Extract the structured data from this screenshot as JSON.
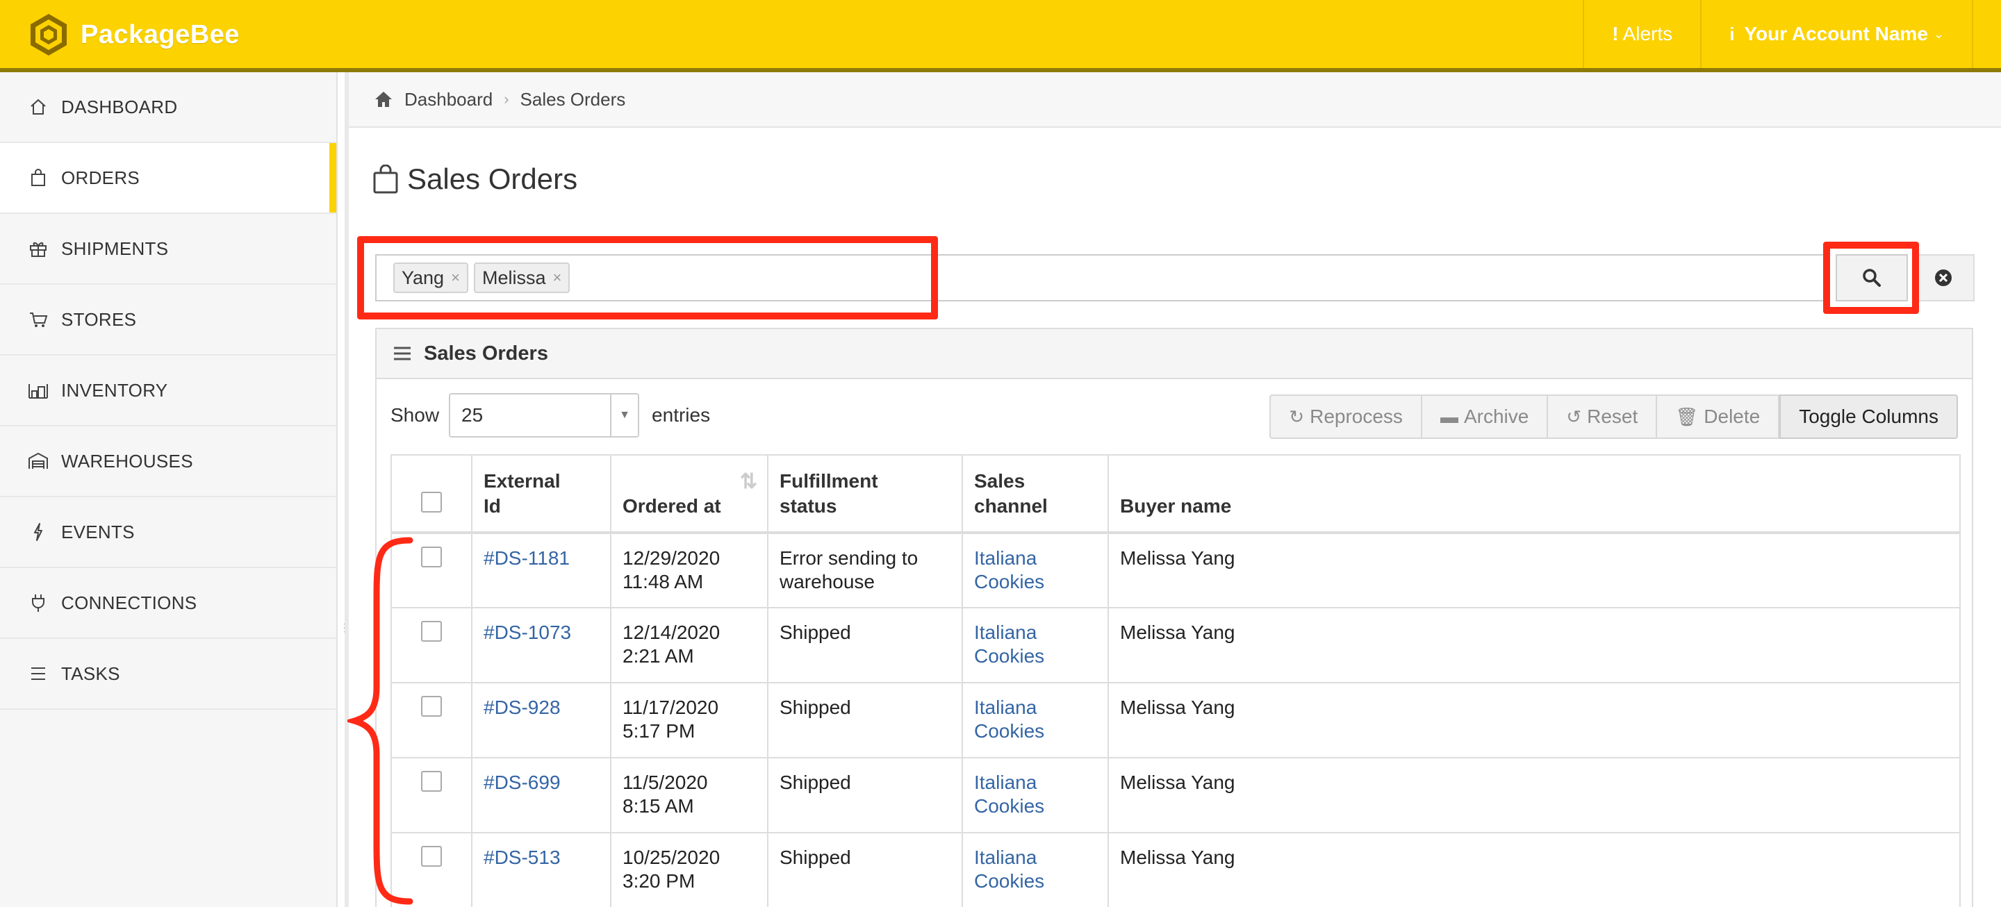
{
  "app": {
    "name": "PackageBee"
  },
  "header": {
    "alerts_label": "Alerts",
    "account_label": "Your Account Name"
  },
  "sidebar": {
    "items": [
      {
        "label": "DASHBOARD",
        "icon": "home-icon"
      },
      {
        "label": "ORDERS",
        "icon": "shopping-bag-icon",
        "active": true
      },
      {
        "label": "SHIPMENTS",
        "icon": "gift-box-icon"
      },
      {
        "label": "STORES",
        "icon": "cart-icon"
      },
      {
        "label": "INVENTORY",
        "icon": "warehouse-shelves-icon"
      },
      {
        "label": "WAREHOUSES",
        "icon": "warehouse-icon"
      },
      {
        "label": "EVENTS",
        "icon": "lightning-icon"
      },
      {
        "label": "CONNECTIONS",
        "icon": "plug-icon"
      },
      {
        "label": "TASKS",
        "icon": "list-icon"
      }
    ]
  },
  "breadcrumb": {
    "home": "Dashboard",
    "current": "Sales Orders"
  },
  "page": {
    "title": "Sales Orders"
  },
  "search": {
    "tags": [
      "Yang",
      "Melissa"
    ]
  },
  "panel": {
    "title": "Sales Orders",
    "show_label": "Show",
    "entries_label": "entries",
    "page_length": "25",
    "buttons": {
      "reprocess": "Reprocess",
      "archive": "Archive",
      "reset": "Reset",
      "delete": "Delete",
      "toggle_columns": "Toggle Columns"
    }
  },
  "table": {
    "headers": {
      "external_id_1": "External",
      "external_id_2": "Id",
      "ordered_at": "Ordered at",
      "fulfillment_1": "Fulfillment",
      "fulfillment_2": "status",
      "channel_1": "Sales",
      "channel_2": "channel",
      "buyer": "Buyer name"
    },
    "rows": [
      {
        "id": "#DS-1181",
        "date": "12/29/2020",
        "time": "11:48 AM",
        "status": "Error sending to warehouse",
        "channel": "Italiana Cookies",
        "buyer": "Melissa Yang"
      },
      {
        "id": "#DS-1073",
        "date": "12/14/2020",
        "time": "2:21 AM",
        "status": "Shipped",
        "channel": "Italiana Cookies",
        "buyer": "Melissa Yang"
      },
      {
        "id": "#DS-928",
        "date": "11/17/2020",
        "time": "5:17 PM",
        "status": "Shipped",
        "channel": "Italiana Cookies",
        "buyer": "Melissa Yang"
      },
      {
        "id": "#DS-699",
        "date": "11/5/2020",
        "time": "8:15 AM",
        "status": "Shipped",
        "channel": "Italiana Cookies",
        "buyer": "Melissa Yang"
      },
      {
        "id": "#DS-513",
        "date": "10/25/2020",
        "time": "3:20 PM",
        "status": "Shipped",
        "channel": "Italiana Cookies",
        "buyer": "Melissa Yang"
      }
    ]
  },
  "colors": {
    "brand_yellow": "#fcd200",
    "annotation_red": "#ff2a16",
    "link_blue": "#3465a4"
  }
}
